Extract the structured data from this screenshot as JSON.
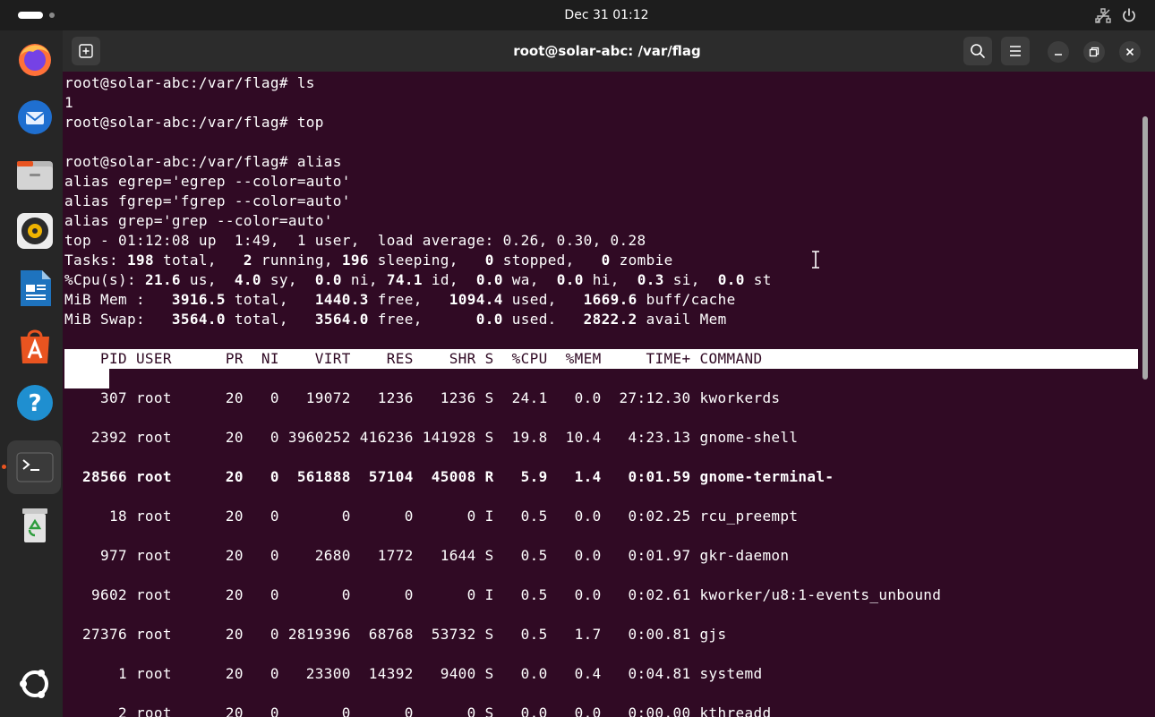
{
  "topbar": {
    "clock": "Dec 31  01:12",
    "icons": [
      "activities-indicator",
      "network-icon",
      "power-icon"
    ]
  },
  "dock": {
    "items": [
      "firefox-icon",
      "thunderbird-icon",
      "files-icon",
      "rhythmbox-icon",
      "libreoffice-writer-icon",
      "app-center-icon",
      "help-icon",
      "terminal-icon",
      "trash-icon",
      "show-apps-icon"
    ],
    "active": "terminal-icon",
    "accent": "#e95420"
  },
  "window": {
    "title": "root@solar-abc: /var/flag",
    "buttons": [
      "new-tab-icon",
      "search-icon",
      "menu-icon",
      "minimize-icon",
      "maximize-icon",
      "close-icon"
    ]
  },
  "terminal": {
    "background": "#300a24",
    "lines": {
      "l1": "root@solar-abc:/var/flag# ls",
      "l2": "1",
      "l3": "root@solar-abc:/var/flag# top",
      "l4": "root@solar-abc:/var/flag# alias",
      "l5": "alias egrep='egrep --color=auto'",
      "l6": "alias fgrep='fgrep --color=auto'",
      "l7": "alias grep='grep --color=auto'",
      "l8": "top - 01:12:08 up  1:49,  1 user,  load average: 0.26, 0.30, 0.28"
    },
    "summary": {
      "tasks": {
        "label": "Tasks:",
        "total": "198",
        "total_lbl": " total,",
        "running": "2",
        "running_lbl": " running,",
        "sleeping": "196",
        "sleeping_lbl": " sleeping,",
        "stopped": "0",
        "stopped_lbl": " stopped,",
        "zombie": "0",
        "zombie_lbl": " zombie"
      },
      "cpu": {
        "label": "%Cpu(s):",
        "us": "21.6",
        "us_lbl": " us,",
        "sy": "4.0",
        "sy_lbl": " sy,",
        "ni": "0.0",
        "ni_lbl": " ni,",
        "id": "74.1",
        "id_lbl": " id,",
        "wa": "0.0",
        "wa_lbl": " wa,",
        "hi": "0.0",
        "hi_lbl": " hi,",
        "si": "0.3",
        "si_lbl": " si,",
        "st": "0.0",
        "st_lbl": " st"
      },
      "mem": {
        "label": "MiB Mem :",
        "total": "3916.5",
        "total_lbl": " total,",
        "free": "1440.3",
        "free_lbl": " free,",
        "used": "1094.4",
        "used_lbl": " used,",
        "cache": "1669.6",
        "cache_lbl": " buff/cache"
      },
      "swap": {
        "label": "MiB Swap:",
        "total": "3564.0",
        "total_lbl": " total,",
        "free": "3564.0",
        "free_lbl": " free,",
        "used": "0.0",
        "used_lbl": " used.",
        "avail": "2822.2",
        "avail_lbl": " avail Mem"
      }
    },
    "process_table": {
      "header": "    PID USER      PR  NI    VIRT    RES    SHR S  %CPU  %MEM     TIME+ COMMAND",
      "rows": [
        "    307 root      20   0   19072   1236   1236 S  24.1   0.0  27:12.30 kworkerds",
        "   2392 root      20   0 3960252 416236 141928 S  19.8  10.4   4:23.13 gnome-shell",
        "  28566 root      20   0  561888  57104  45008 R   5.9   1.4   0:01.59 gnome-terminal-",
        "     18 root      20   0       0      0      0 I   0.5   0.0   0:02.25 rcu_preempt",
        "    977 root      20   0    2680   1772   1644 S   0.5   0.0   0:01.97 gkr-daemon",
        "   9602 root      20   0       0      0      0 I   0.5   0.0   0:02.61 kworker/u8:1-events_unbound",
        "  27376 root      20   0 2819396  68768  53732 S   0.5   1.7   0:00.81 gjs",
        "      1 root      20   0   23300  14392   9400 S   0.0   0.4   0:04.81 systemd",
        "      2 root      20   0       0      0      0 S   0.0   0.0   0:00.00 kthreadd"
      ],
      "highlighted_row": 2
    }
  }
}
